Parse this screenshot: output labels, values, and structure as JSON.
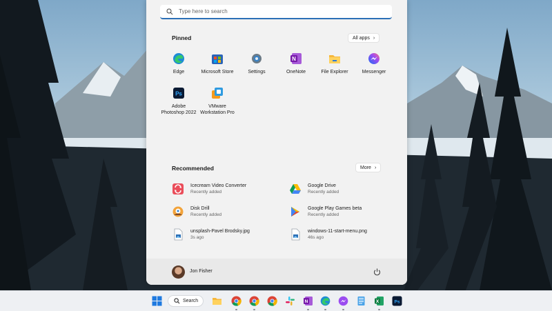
{
  "search": {
    "placeholder": "Type here to search"
  },
  "pinned": {
    "title": "Pinned",
    "all_apps_label": "All apps",
    "apps": [
      {
        "label": "Edge",
        "icon": "edge-icon"
      },
      {
        "label": "Microsoft Store",
        "icon": "store-icon"
      },
      {
        "label": "Settings",
        "icon": "settings-icon"
      },
      {
        "label": "OneNote",
        "icon": "onenote-icon"
      },
      {
        "label": "File Explorer",
        "icon": "folder-icon"
      },
      {
        "label": "Messenger",
        "icon": "messenger-icon"
      },
      {
        "label": "Adobe\nPhotoshop 2022",
        "icon": "photoshop-icon"
      },
      {
        "label": "VMware\nWorkstation Pro",
        "icon": "vmware-icon"
      }
    ]
  },
  "recommended": {
    "title": "Recommended",
    "more_label": "More",
    "items": [
      {
        "name": "Icecream Video Converter",
        "sub": "Recently added",
        "icon": "icecream-icon"
      },
      {
        "name": "Google Drive",
        "sub": "Recently added",
        "icon": "google-drive-icon"
      },
      {
        "name": "Disk Drill",
        "sub": "Recently added",
        "icon": "disk-drill-icon"
      },
      {
        "name": "Google Play Games beta",
        "sub": "Recently added",
        "icon": "google-play-games-icon"
      },
      {
        "name": "unsplash-Pavel Brodsky.jpg",
        "sub": "3s ago",
        "icon": "image-file-icon"
      },
      {
        "name": "windows-11-start-menu.png",
        "sub": "46s ago",
        "icon": "image-file-icon"
      }
    ]
  },
  "user": {
    "name": "Jon Fisher"
  },
  "taskbar": {
    "search_label": "Search",
    "icons": [
      "windows-start-icon",
      "file-explorer-icon",
      "chrome-icon",
      "chrome-icon",
      "chrome-icon",
      "slack-icon",
      "onenote-icon",
      "edge-icon",
      "messenger-icon",
      "notepad-icon",
      "excel-icon",
      "photoshop-icon"
    ]
  },
  "colors": {
    "accent": "#2b6fb6",
    "menu_bg": "#f2f2f2",
    "taskbar_bg": "#eef0f3"
  }
}
